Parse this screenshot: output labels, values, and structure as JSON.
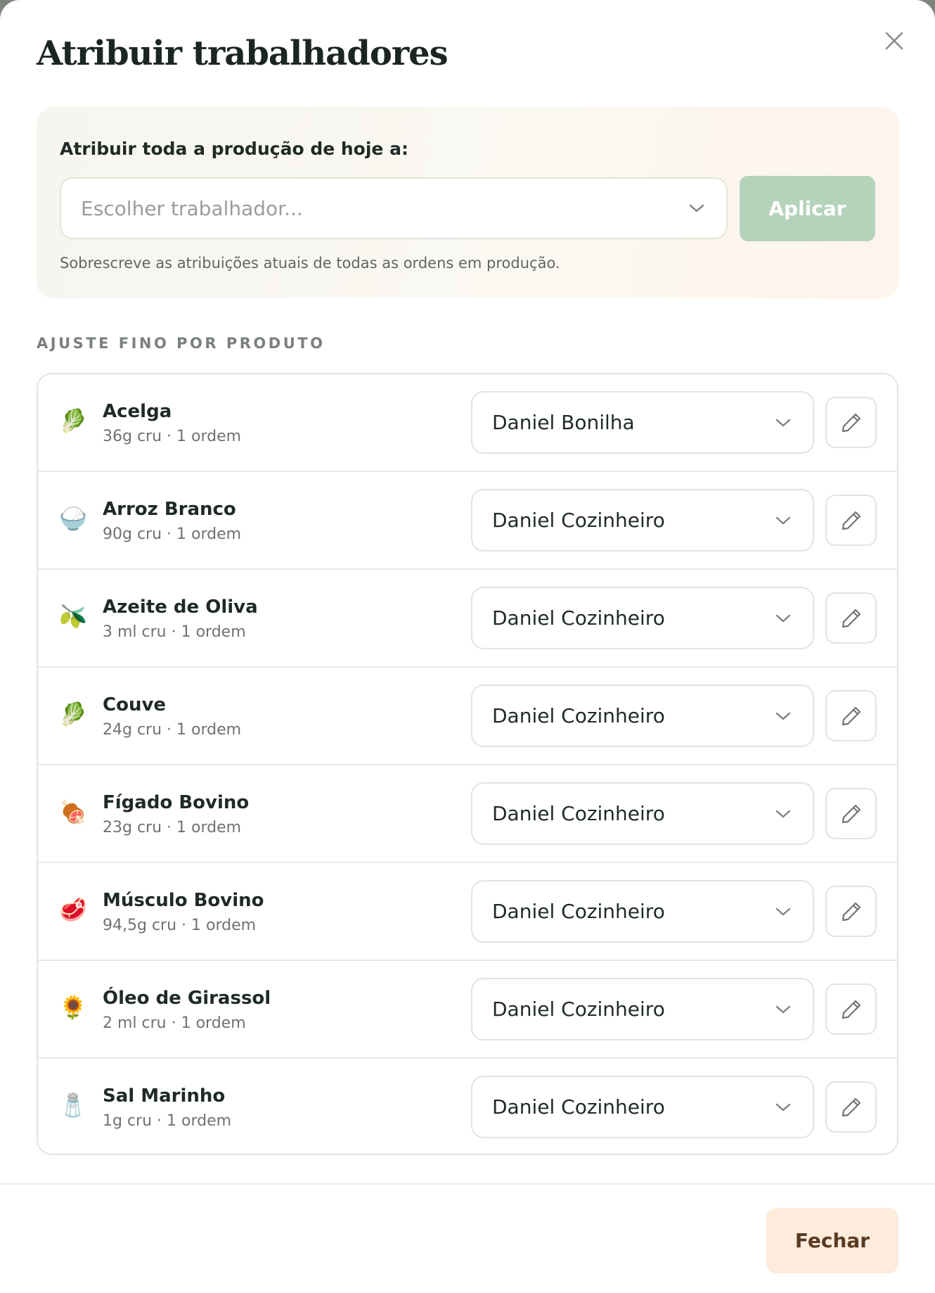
{
  "modal": {
    "title": "Atribuir trabalhadores",
    "close_icon": "close-icon"
  },
  "bulk": {
    "label": "Atribuir toda a produção de hoje a:",
    "select_placeholder": "Escolher trabalhador...",
    "apply_label": "Aplicar",
    "note": "Sobrescreve as atribuições atuais de todas as ordens em produção."
  },
  "section": {
    "label": "AJUSTE FINO POR PRODUTO"
  },
  "products": [
    {
      "name": "Acelga",
      "meta": "36g cru · 1 ordem",
      "icon": "🥬",
      "icon_name": "leafy-green-icon",
      "worker": "Daniel Bonilha"
    },
    {
      "name": "Arroz Branco",
      "meta": "90g cru · 1 ordem",
      "icon": "🍚",
      "icon_name": "rice-bowl-icon",
      "worker": "Daniel Cozinheiro"
    },
    {
      "name": "Azeite de Oliva",
      "meta": "3 ml cru · 1 ordem",
      "icon": "🫒",
      "icon_name": "olive-icon",
      "worker": "Daniel Cozinheiro"
    },
    {
      "name": "Couve",
      "meta": "24g cru · 1 ordem",
      "icon": "🥬",
      "icon_name": "leafy-green-icon",
      "worker": "Daniel Cozinheiro"
    },
    {
      "name": "Fígado Bovino",
      "meta": "23g cru · 1 ordem",
      "icon": "🍖",
      "icon_name": "meat-on-bone-icon",
      "worker": "Daniel Cozinheiro"
    },
    {
      "name": "Músculo Bovino",
      "meta": "94,5g cru · 1 ordem",
      "icon": "🥩",
      "icon_name": "steak-icon",
      "worker": "Daniel Cozinheiro"
    },
    {
      "name": "Óleo de Girassol",
      "meta": "2 ml cru · 1 ordem",
      "icon": "🌻",
      "icon_name": "sunflower-icon",
      "worker": "Daniel Cozinheiro"
    },
    {
      "name": "Sal Marinho",
      "meta": "1g cru · 1 ordem",
      "icon": "🧂",
      "icon_name": "salt-shaker-icon",
      "worker": "Daniel Cozinheiro"
    }
  ],
  "footer": {
    "close_label": "Fechar"
  },
  "colors": {
    "apply_bg": "#b5d3bb",
    "close_bg": "#fdebdc",
    "close_text": "#5a3a22",
    "border": "#e6e3da"
  }
}
